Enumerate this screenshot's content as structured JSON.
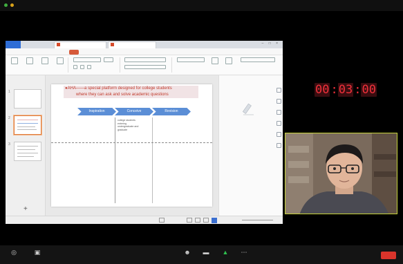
{
  "meeting": {
    "status": "",
    "view_label": "",
    "timer": "00:03:00",
    "timer_digits": [
      "00",
      "03",
      "00"
    ],
    "vcam_label": "",
    "participant_name": "",
    "accent": "#c8d43a",
    "end_color": "#d9342b"
  },
  "app": {
    "home_tab": "",
    "doc_tabs": [
      "",
      ""
    ],
    "menus": [
      "",
      "",
      "",
      "",
      "",
      "",
      "",
      "",
      "",
      "",
      ""
    ],
    "active_menu_index": 2,
    "slide_panel_header": "",
    "right_pane_header": "",
    "right_pane_text1": "",
    "right_pane_text2": "",
    "status_left": "",
    "zoom": ""
  },
  "slide": {
    "headline_line1": "●AHA——a special platform designed for college students",
    "headline_line2": "where they can ask and solve academic questions",
    "stages": [
      "Inspiration",
      "Conceive",
      "Revision"
    ],
    "col_left": "",
    "col_mid": "college students\nentering\nundergraduate and\ngraduate",
    "col_right": "",
    "headline_color": "#c0392b",
    "stage_color": "#5b8ed6"
  },
  "bottom_bar": {
    "items": [
      {
        "icon": "mic-icon",
        "label": ""
      },
      {
        "icon": "camera-icon",
        "label": ""
      },
      {
        "icon": "participants-icon",
        "label": ""
      },
      {
        "icon": "chat-icon",
        "label": ""
      },
      {
        "icon": "share-icon",
        "label": ""
      },
      {
        "icon": "more-icon",
        "label": ""
      }
    ],
    "end_label": ""
  }
}
